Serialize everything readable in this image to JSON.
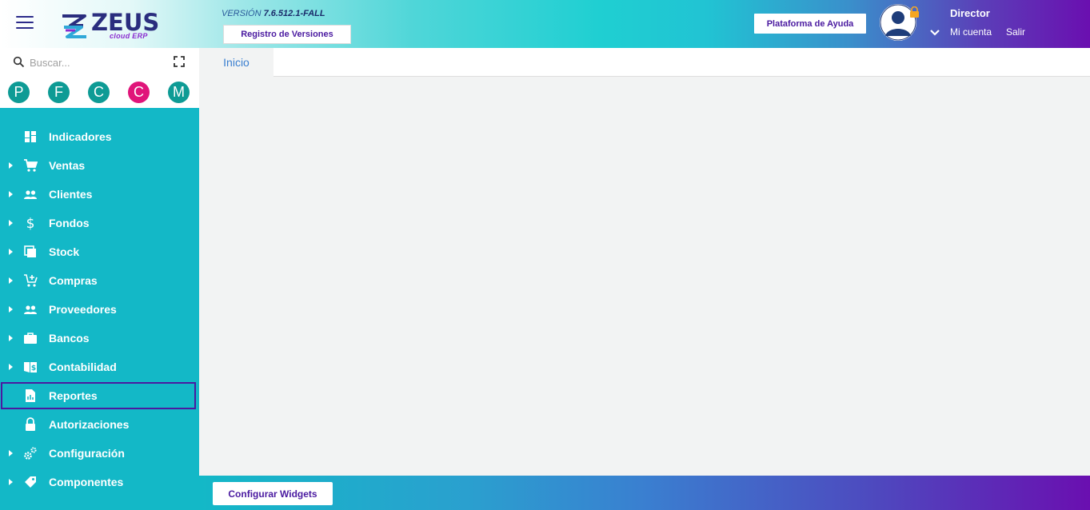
{
  "header": {
    "logo_text": "ZEUS",
    "logo_sub": "cloud ERP",
    "version_label": "VERSIÓN",
    "version_number": "7.6.512.1-FALL",
    "registro_label": "Registro de Versiones",
    "help_label": "Plataforma de Ayuda",
    "user_role": "Director",
    "account_label": "Mi cuenta",
    "logout_label": "Salir"
  },
  "sidebar": {
    "search_placeholder": "Buscar...",
    "quick_access": [
      {
        "letter": "P",
        "color": "#0e9b95"
      },
      {
        "letter": "F",
        "color": "#0e9b95"
      },
      {
        "letter": "C",
        "color": "#0e9b95"
      },
      {
        "letter": "C",
        "color": "#e0157a"
      },
      {
        "letter": "M",
        "color": "#0e9b95"
      }
    ],
    "items": [
      {
        "label": "Indicadores",
        "icon": "dashboard-icon",
        "expandable": false
      },
      {
        "label": "Ventas",
        "icon": "cart-icon",
        "expandable": true
      },
      {
        "label": "Clientes",
        "icon": "people-icon",
        "expandable": true
      },
      {
        "label": "Fondos",
        "icon": "dollar-icon",
        "expandable": true
      },
      {
        "label": "Stock",
        "icon": "stock-icon",
        "expandable": true
      },
      {
        "label": "Compras",
        "icon": "cart-plus-icon",
        "expandable": true
      },
      {
        "label": "Proveedores",
        "icon": "people-icon",
        "expandable": true
      },
      {
        "label": "Bancos",
        "icon": "briefcase-icon",
        "expandable": true
      },
      {
        "label": "Contabilidad",
        "icon": "ledger-icon",
        "expandable": true
      },
      {
        "label": "Reportes",
        "icon": "report-icon",
        "expandable": false,
        "selected": true
      },
      {
        "label": "Autorizaciones",
        "icon": "lock-icon",
        "expandable": false
      },
      {
        "label": "Configuración",
        "icon": "gears-icon",
        "expandable": true
      },
      {
        "label": "Componentes",
        "icon": "tag-icon",
        "expandable": true
      }
    ]
  },
  "main": {
    "tab_label": "Inicio"
  },
  "footer": {
    "widgets_label": "Configurar Widgets"
  },
  "colors": {
    "accent_purple": "#4a1aa0",
    "sidebar_teal": "#13b8c7",
    "tab_blue": "#3a7fd0"
  }
}
